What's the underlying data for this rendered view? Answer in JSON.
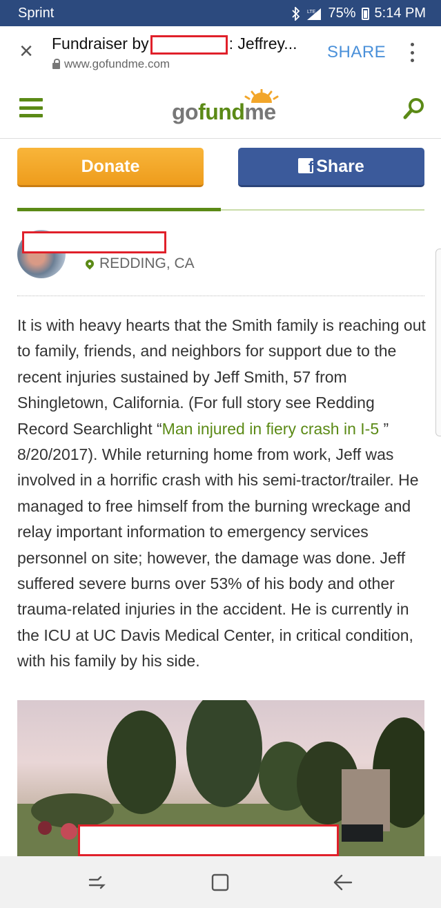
{
  "status_bar": {
    "carrier": "Sprint",
    "battery": "75%",
    "time": "5:14 PM",
    "icons": [
      "bluetooth-icon",
      "signal-lte-icon",
      "battery-icon"
    ]
  },
  "tab_bar": {
    "title_prefix": "Fundraiser by",
    "title_suffix": ": Jeffrey...",
    "url": "www.gofundme.com",
    "share_label": "SHARE"
  },
  "site": {
    "logo_go": "go",
    "logo_fund": "fund",
    "logo_me": "me",
    "brand_green": "#5b8a16"
  },
  "actions": {
    "donate_label": "Donate",
    "share_label": "Share",
    "fb_glyph": "f",
    "donate_color": "#f2a62a",
    "share_color": "#3b5a9b"
  },
  "progress": {
    "fraction": 0.5
  },
  "organizer": {
    "location": "REDDING, CA"
  },
  "story": {
    "before_link": "It is with heavy hearts that the Smith family is reaching out to family,  friends, and neighbors for support due to the recent injuries sustained by Jeff Smith, 57 from Shingletown, California. (For full story see Redding Record Searchlight “",
    "link_text": "Man injured in fiery crash in I-5",
    "after_link": " ” 8/20/2017).  While returning home from work, Jeff was involved in a horrific crash with his semi-tractor/trailer.  He managed to free himself from the burning wreckage and relay important information to emergency services personnel on site; however, the damage was done.  Jeff suffered severe burns over 53% of his body and other trauma-related injuries in the accident.  He is currently in the ICU at UC Davis Medical Center, in critical condition, with his family by his side."
  },
  "nav_bar": {
    "icons": [
      "recents-icon",
      "home-icon",
      "back-icon"
    ]
  }
}
